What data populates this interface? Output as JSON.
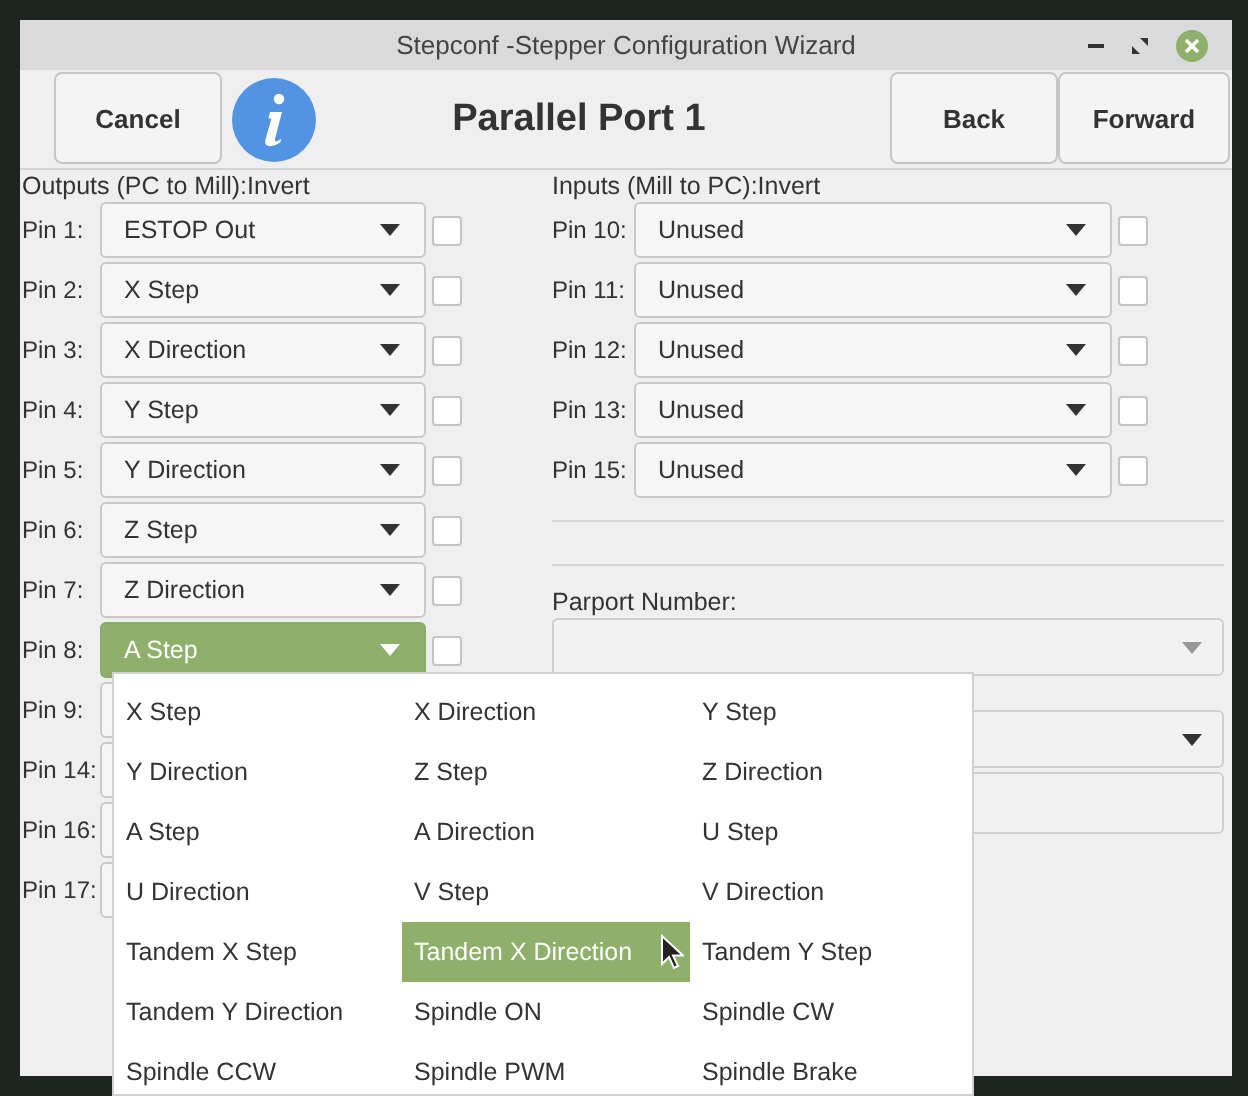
{
  "window": {
    "title": "Stepconf -Stepper Configuration Wizard"
  },
  "header": {
    "cancel": "Cancel",
    "title": "Parallel Port 1",
    "back": "Back",
    "forward": "Forward"
  },
  "outputs": {
    "label": "Outputs (PC to Mill):Invert",
    "pins": [
      {
        "pin": "Pin 1:",
        "value": "ESTOP Out",
        "invert": false,
        "open": false
      },
      {
        "pin": "Pin 2:",
        "value": "X Step",
        "invert": false,
        "open": false
      },
      {
        "pin": "Pin 3:",
        "value": "X Direction",
        "invert": false,
        "open": false
      },
      {
        "pin": "Pin 4:",
        "value": "Y Step",
        "invert": false,
        "open": false
      },
      {
        "pin": "Pin 5:",
        "value": "Y Direction",
        "invert": false,
        "open": false
      },
      {
        "pin": "Pin 6:",
        "value": "Z Step",
        "invert": false,
        "open": false
      },
      {
        "pin": "Pin 7:",
        "value": "Z Direction",
        "invert": false,
        "open": false
      },
      {
        "pin": "Pin 8:",
        "value": "A Step",
        "invert": false,
        "open": true
      },
      {
        "pin": "Pin 9:"
      },
      {
        "pin": "Pin 14:"
      },
      {
        "pin": "Pin 16:"
      },
      {
        "pin": "Pin 17:"
      }
    ]
  },
  "inputs": {
    "label": "Inputs (Mill to PC):Invert",
    "pins": [
      {
        "pin": "Pin 10:",
        "value": "Unused",
        "invert": false
      },
      {
        "pin": "Pin 11:",
        "value": "Unused",
        "invert": false
      },
      {
        "pin": "Pin 12:",
        "value": "Unused",
        "invert": false
      },
      {
        "pin": "Pin 13:",
        "value": "Unused",
        "invert": false
      },
      {
        "pin": "Pin 15:",
        "value": "Unused",
        "invert": false
      }
    ]
  },
  "parport": {
    "label": "Parport Number:"
  },
  "extra_fields": [
    {
      "kind": "combo"
    },
    {
      "kind": "entry"
    }
  ],
  "dropdown": {
    "items": [
      {
        "label": "X Step",
        "selected": false
      },
      {
        "label": "X Direction",
        "selected": false
      },
      {
        "label": "Y Step",
        "selected": false
      },
      {
        "label": "Y Direction",
        "selected": false
      },
      {
        "label": "Z Step",
        "selected": false
      },
      {
        "label": "Z Direction",
        "selected": false
      },
      {
        "label": "A Step",
        "selected": false
      },
      {
        "label": "A Direction",
        "selected": false
      },
      {
        "label": "U Step",
        "selected": false
      },
      {
        "label": "U Direction",
        "selected": false
      },
      {
        "label": "V Step",
        "selected": false
      },
      {
        "label": "V Direction",
        "selected": false
      },
      {
        "label": "Tandem X Step",
        "selected": false
      },
      {
        "label": "Tandem X Direction",
        "selected": true
      },
      {
        "label": "Tandem Y Step",
        "selected": false
      },
      {
        "label": "Tandem Y Direction",
        "selected": false
      },
      {
        "label": "Spindle ON",
        "selected": false
      },
      {
        "label": "Spindle CW",
        "selected": false
      },
      {
        "label": "Spindle CCW",
        "selected": false
      },
      {
        "label": "Spindle PWM",
        "selected": false
      },
      {
        "label": "Spindle Brake",
        "selected": false
      }
    ]
  }
}
